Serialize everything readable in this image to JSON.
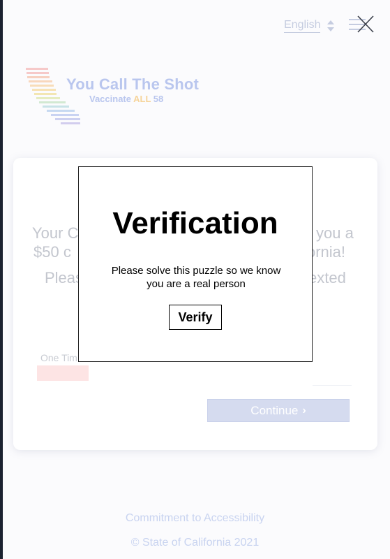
{
  "header": {
    "language": "English"
  },
  "logo": {
    "title": "You Call The Shot",
    "subtitle_prefix": "Vaccinate ",
    "subtitle_highlight": "ALL",
    "subtitle_suffix": " 58"
  },
  "card": {
    "line1_left": "Your C",
    "line1_right": "l you a",
    "line2_left": "$50 c",
    "line2_right": "ornia!",
    "line3_left": "Pleas",
    "line3_right": "exted",
    "otp_label": "One Tim",
    "continue_label": "Continue"
  },
  "modal": {
    "title": "Verification",
    "message": "Please solve this puzzle so we know you are a real person",
    "verify_label": "Verify"
  },
  "footer": {
    "accessibility": "Commitment to Accessibility",
    "copyright": "© State of California 2021"
  },
  "colors": {
    "faded_text": "#c3c6ce",
    "link": "#c8d3f0",
    "button_disabled": "#d5dbef"
  }
}
